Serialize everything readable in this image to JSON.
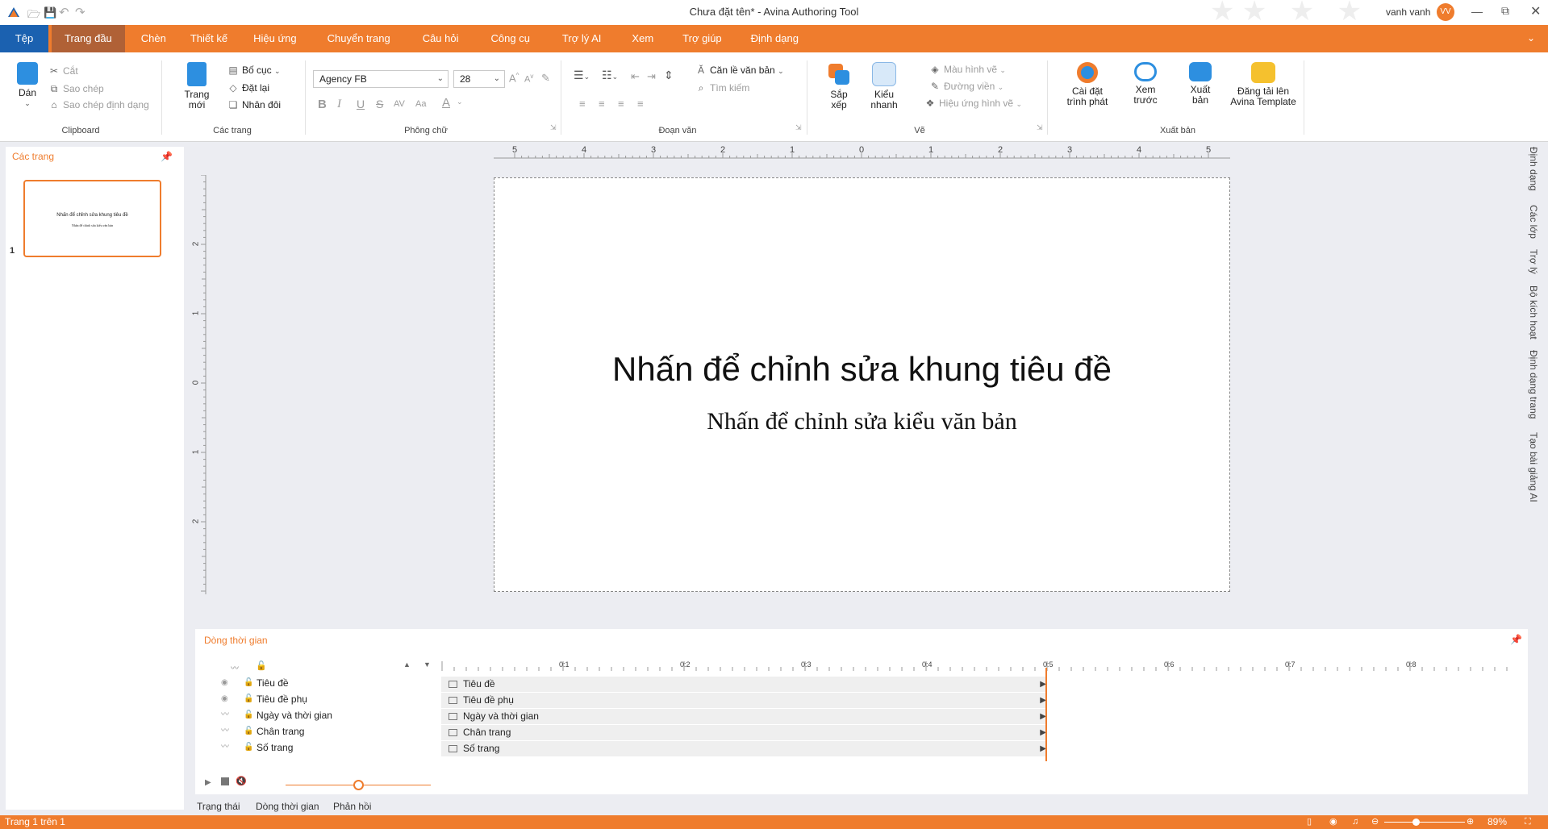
{
  "window": {
    "title": "Chưa đặt tên* - Avina Authoring Tool",
    "user": "vanh vanh",
    "avatar_initials": "VV"
  },
  "menu": {
    "file": "Tệp",
    "tabs": [
      "Trang đầu",
      "Chèn",
      "Thiết kế",
      "Hiệu ứng",
      "Chuyển trang",
      "Câu hỏi",
      "Công cụ",
      "Trợ lý AI",
      "Xem",
      "Trợ giúp",
      "Định dạng"
    ]
  },
  "ribbon": {
    "clipboard": {
      "paste": "Dán",
      "cut": "Cắt",
      "copy": "Sao chép",
      "format_painter": "Sao chép định dạng",
      "label": "Clipboard"
    },
    "pages": {
      "new_page_line1": "Trang",
      "new_page_line2": "mới",
      "layout": "Bố cục",
      "reset": "Đặt lại",
      "duplicate": "Nhân đôi",
      "label": "Các trang"
    },
    "font": {
      "family": "Agency FB",
      "size": "28",
      "label": "Phông chữ"
    },
    "paragraph": {
      "align": "Căn lề văn bản",
      "find": "Tìm kiếm",
      "label": "Đoạn văn"
    },
    "draw": {
      "arrange_line1": "Sắp",
      "arrange_line2": "xếp",
      "quick_line1": "Kiểu",
      "quick_line2": "nhanh",
      "fill": "Màu hình vẽ",
      "outline": "Đường viền",
      "effects": "Hiệu ứng hình vẽ",
      "label": "Vẽ"
    },
    "publish": {
      "player_line1": "Cài đặt",
      "player_line2": "trình phát",
      "preview_line1": "Xem",
      "preview_line2": "trước",
      "export_line1": "Xuất",
      "export_line2": "bản",
      "upload_line1": "Đăng tải lên",
      "upload_line2": "Avina Template",
      "label": "Xuất bản"
    }
  },
  "pages_panel": {
    "title": "Các trang",
    "thumb_title": "Nhấn để chỉnh sửa khung tiêu đề",
    "thumb_sub": "Nhấn để chỉnh sửa kiểu văn bản",
    "page_number": "1"
  },
  "ruler": {
    "h_ticks": [
      "5",
      "4",
      "3",
      "2",
      "1",
      "0",
      "1",
      "2",
      "3",
      "4",
      "5"
    ],
    "v_ticks": [
      "2",
      "1",
      "0",
      "1",
      "2"
    ]
  },
  "slide": {
    "title": "Nhấn để chỉnh sửa khung tiêu đề",
    "subtitle": "Nhấn để chỉnh sửa kiểu văn bản"
  },
  "timeline": {
    "title": "Dòng thời gian",
    "ticks": [
      "0:1",
      "0:2",
      "0:3",
      "0:4",
      "0:5",
      "0:6",
      "0:7",
      "0:8"
    ],
    "rows": [
      "Tiêu đề",
      "Tiêu đề phụ",
      "Ngày và thời gian",
      "Chân trang",
      "Số trang"
    ],
    "playhead_seconds": 5,
    "volume_level": 0.5
  },
  "bottom_tabs": [
    "Trạng thái",
    "Dòng thời gian",
    "Phản hồi"
  ],
  "side_tabs": [
    "Định dạng",
    "Các lớp",
    "Trợ lý",
    "Bộ kích hoạt",
    "Định dạng trang",
    "Tạo bài giảng AI"
  ],
  "status": {
    "page_info": "Trang 1 trên 1",
    "zoom": "89%",
    "zoom_level": 0.89
  },
  "colors": {
    "accent": "#ef7c2d",
    "file_tab": "#1b61b0",
    "active_tab": "#b06136"
  }
}
